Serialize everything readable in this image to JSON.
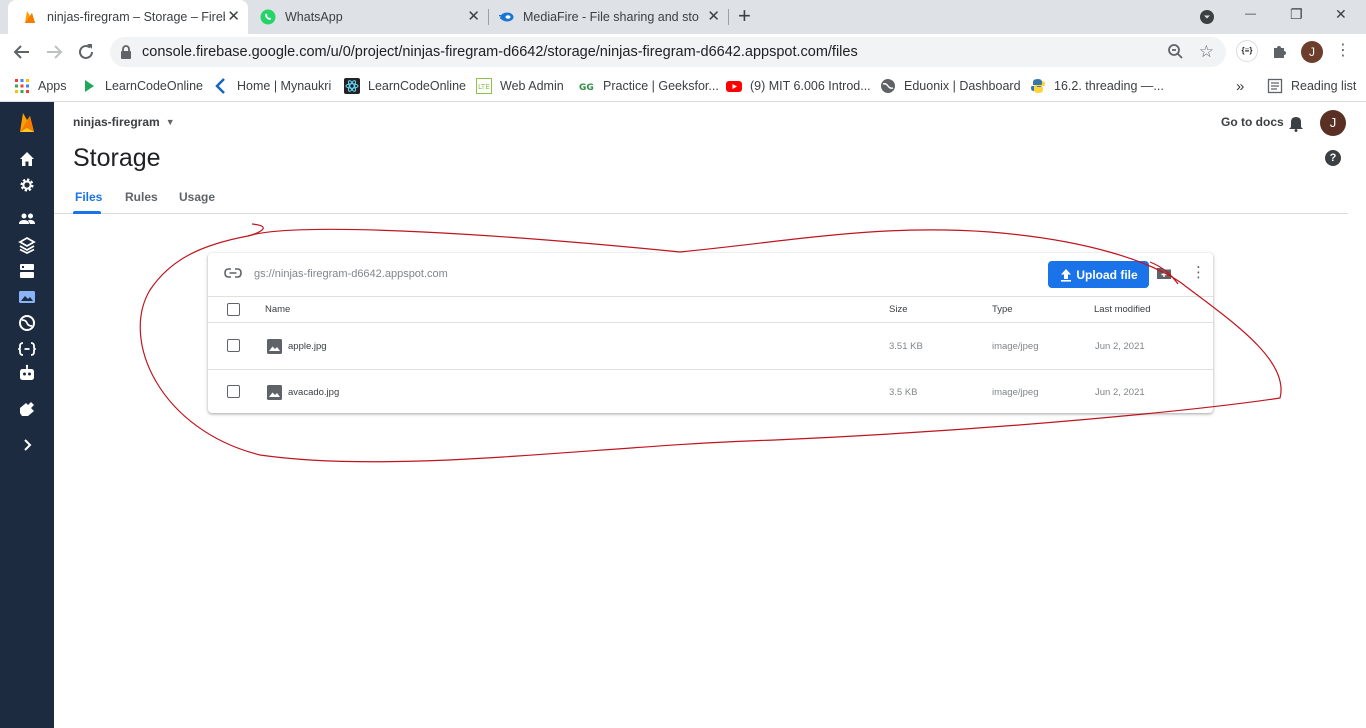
{
  "browser": {
    "tabs": [
      {
        "title": "ninjas-firegram – Storage – Firebase",
        "close": "✕"
      },
      {
        "title": "WhatsApp",
        "close": "✕"
      },
      {
        "title": "MediaFire - File sharing and storage",
        "close": "✕"
      }
    ],
    "new_tab": "+",
    "window_controls": {
      "minimize": "—",
      "restore": "❐",
      "close": "✕"
    },
    "url": "console.firebase.google.com/u/0/project/ninjas-firegram-d6642/storage/ninjas-firegram-d6642.appspot.com/files",
    "profile_initial": "J",
    "ext_label": "{≡}"
  },
  "bookmarks": {
    "items": [
      {
        "label": "Apps",
        "icon": "apps-grid-icon"
      },
      {
        "label": "LearnCodeOnline",
        "icon": "play-icon"
      },
      {
        "label": "Home | Mynaukri",
        "icon": "k-logo-icon"
      },
      {
        "label": "LearnCodeOnline",
        "icon": "react-icon"
      },
      {
        "label": "Web Admin",
        "icon": "lte-icon"
      },
      {
        "label": "Practice | Geeksfor...",
        "icon": "gfg-icon"
      },
      {
        "label": "(9) MIT 6.006 Introd...",
        "icon": "youtube-icon"
      },
      {
        "label": "Eduonix | Dashboard",
        "icon": "globe-icon"
      },
      {
        "label": "16.2. threading —...",
        "icon": "python-icon"
      }
    ],
    "overflow": "»",
    "reading_list": "Reading list"
  },
  "firebase": {
    "project_name": "ninjas-firegram",
    "go_to_docs": "Go to docs",
    "user_initial": "J",
    "page_title": "Storage",
    "help": "?",
    "tabs": [
      "Files",
      "Rules",
      "Usage"
    ],
    "active_tab": "Files"
  },
  "storage": {
    "bucket_path": "gs://ninjas-firegram-d6642.appspot.com",
    "upload_label": "Upload file",
    "columns": {
      "name": "Name",
      "size": "Size",
      "type": "Type",
      "modified": "Last modified"
    },
    "files": [
      {
        "name": "apple.jpg",
        "size": "3.51 KB",
        "type": "image/jpeg",
        "modified": "Jun 2, 2021"
      },
      {
        "name": "avacado.jpg",
        "size": "3.5 KB",
        "type": "image/jpeg",
        "modified": "Jun 2, 2021"
      }
    ]
  },
  "colors": {
    "accent": "#1a73e8",
    "sidebar": "#1c2b40",
    "annotation_ink": "#c0141f"
  }
}
